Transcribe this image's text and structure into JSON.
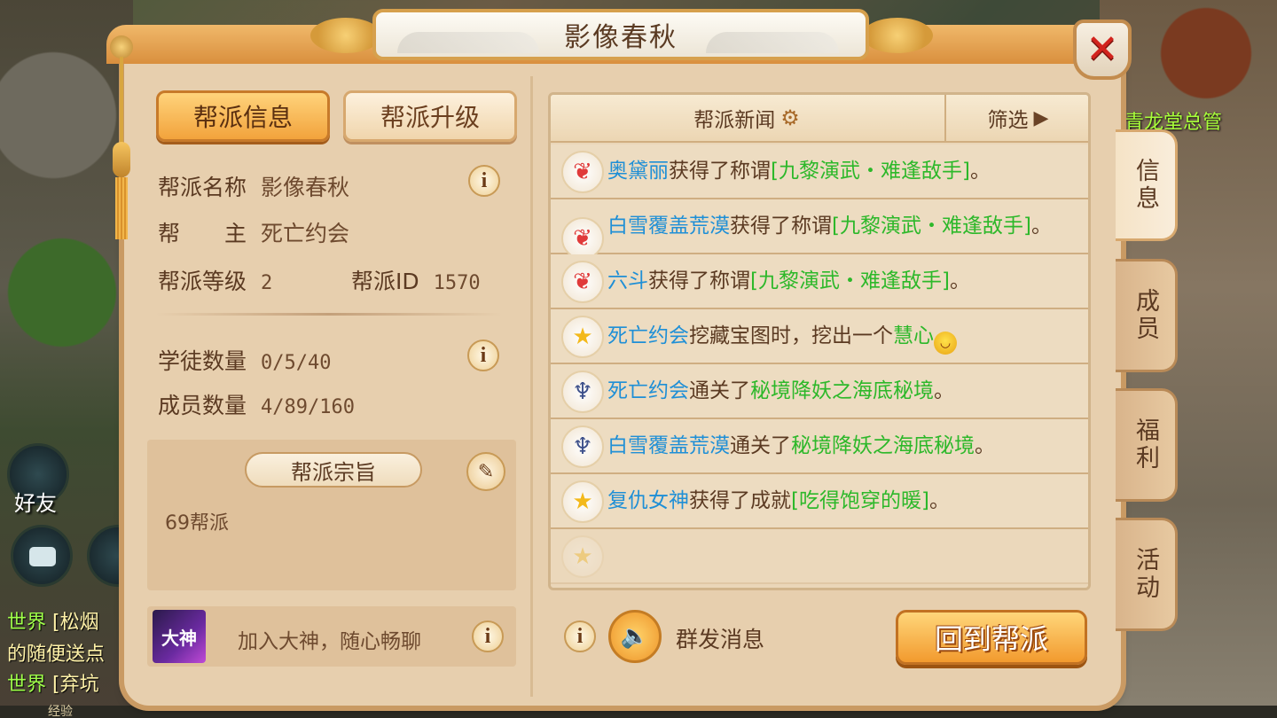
{
  "window": {
    "title": "影像春秋"
  },
  "world": {
    "npc_label": "青龙堂总管",
    "friend_label": "好友",
    "chat_lines": [
      {
        "channel": "世界",
        "message": "[松烟"
      },
      {
        "channel": "",
        "message": "的随便送点"
      },
      {
        "channel": "世界",
        "message": "[弃坑"
      }
    ],
    "exp_label": "经验"
  },
  "left_tabs": {
    "info": "帮派信息",
    "upgrade": "帮派升级"
  },
  "guild": {
    "name_label": "帮派名称",
    "name_value": "影像春秋",
    "leader_label": "帮　　主",
    "leader_value": "死亡约会",
    "level_label": "帮派等级",
    "level_value": "2",
    "id_label": "帮派ID",
    "id_value": "1570",
    "apprentice_label": "学徒数量",
    "apprentice_value": "0/5/40",
    "member_label": "成员数量",
    "member_value": "4/89/160",
    "motto_title": "帮派宗旨",
    "motto_text": "69帮派",
    "dashen_logo": "大神",
    "dashen_text": "加入大神，随心畅聊"
  },
  "news": {
    "header": "帮派新闻",
    "filter": "筛选",
    "items": [
      {
        "icon": "wing",
        "name": "奥黛丽",
        "verb": "获得了称谓",
        "highlight": "[九黎演武・难逢敌手]",
        "tail": "。"
      },
      {
        "icon": "wing",
        "name": "白雪覆盖荒漠",
        "verb": "获得了称谓",
        "highlight": "[九黎演武・难逢敌手]",
        "tail": "。"
      },
      {
        "icon": "wing",
        "name": "六斗",
        "verb": "获得了称谓",
        "highlight": "[九黎演武・难逢敌手]",
        "tail": "。"
      },
      {
        "icon": "star",
        "name": "死亡约会",
        "verb": "挖藏宝图时，挖出一个",
        "highlight": "慧心",
        "tail": ""
      },
      {
        "icon": "mask",
        "name": "死亡约会",
        "verb": "通关了",
        "highlight": "秘境降妖之海底秘境",
        "tail": "。"
      },
      {
        "icon": "mask",
        "name": "白雪覆盖荒漠",
        "verb": "通关了",
        "highlight": "秘境降妖之海底秘境",
        "tail": "。"
      },
      {
        "icon": "star",
        "name": "复仇女神",
        "verb": "获得了成就",
        "highlight": "[吃得饱穿的暖]",
        "tail": "。"
      }
    ]
  },
  "bottom": {
    "broadcast": "群发消息",
    "return": "回到帮派"
  },
  "side_tabs": [
    "信息",
    "成员",
    "福利",
    "活动"
  ],
  "icons": {
    "close": "close-icon",
    "info": "info-icon",
    "edit": "pencil-icon",
    "gear": "gear-icon",
    "speaker": "speaker-icon",
    "filter": "play-arrow-icon"
  },
  "colors": {
    "name": "#1f8fd6",
    "highlight": "#2db82a",
    "close": "#d2231d"
  }
}
